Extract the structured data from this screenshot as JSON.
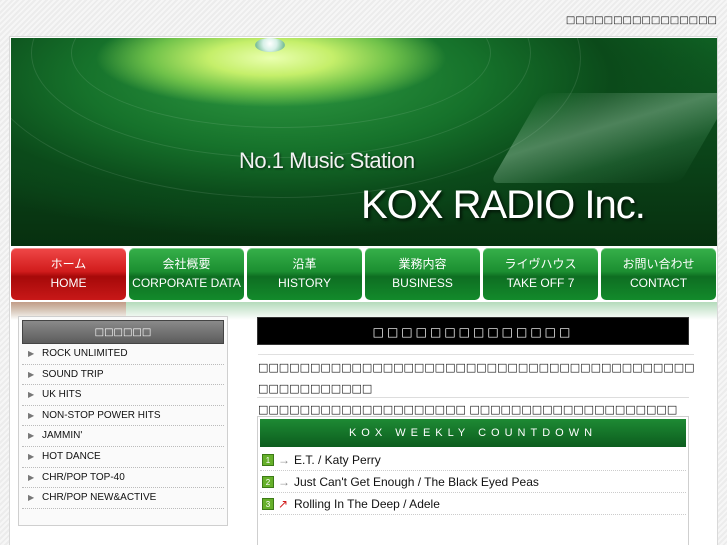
{
  "topbar": {
    "text": "□□□□□□□□□□□□□□□□"
  },
  "banner": {
    "tagline": "No.1 Music Station",
    "brand": "KOX RADIO Inc."
  },
  "nav": {
    "items": [
      {
        "jp": "ホーム",
        "en": "HOME",
        "active": true
      },
      {
        "jp": "会社概要",
        "en": "CORPORATE DATA",
        "active": false
      },
      {
        "jp": "沿革",
        "en": "HISTORY",
        "active": false
      },
      {
        "jp": "業務内容",
        "en": "BUSINESS",
        "active": false
      },
      {
        "jp": "ライヴハウス",
        "en": "TAKE OFF 7",
        "active": false
      },
      {
        "jp": "お問い合わせ",
        "en": "CONTACT",
        "active": false
      }
    ]
  },
  "sidebar": {
    "title": "□□□□□□",
    "items": [
      "ROCK UNLIMITED",
      "SOUND TRIP",
      "UK HITS",
      "NON-STOP POWER HITS",
      "JAMMIN'",
      "HOT DANCE",
      "CHR/POP TOP-40",
      "CHR/POP NEW&ACTIVE"
    ]
  },
  "notice": {
    "heading": "□□□□□□□□□□□□□□",
    "line1": "□□□□□□□□□□□□□□□□□□□□□□□□□□□□□□□□□□□□□□□□□□ □□□□□□□□□□□",
    "line2": "□□□□□□□□□□□□□□□□□□□□ □□□□□□□□□□□□□□□□□□□□"
  },
  "countdown": {
    "title": "KOX WEEKLY COUNTDOWN",
    "entries": [
      {
        "rank": "1",
        "trend": "→",
        "trend_type": "flat",
        "song": "E.T. / Katy Perry"
      },
      {
        "rank": "2",
        "trend": "→",
        "trend_type": "flat",
        "song": "Just Can't Get Enough / The Black Eyed Peas"
      },
      {
        "rank": "3",
        "trend": "↗",
        "trend_type": "up",
        "song": "Rolling In The Deep / Adele"
      }
    ]
  },
  "colors": {
    "nav_green": "#1c8f31",
    "nav_active_red": "#d11c1c",
    "countdown_green": "#0c5d1e"
  }
}
